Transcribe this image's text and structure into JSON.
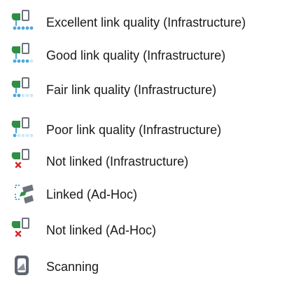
{
  "legend": {
    "items": [
      {
        "icon": "excellent-link-quality-infrastructure-icon",
        "label": "Excellent link quality (Infrastructure)"
      },
      {
        "icon": "good-link-quality-infrastructure-icon",
        "label": "Good link quality (Infrastructure)"
      },
      {
        "icon": "fair-link-quality-infrastructure-icon",
        "label": "Fair link quality (Infrastructure)"
      },
      {
        "icon": "poor-link-quality-infrastructure-icon",
        "label": "Poor link quality (Infrastructure)"
      },
      {
        "icon": "not-linked-infrastructure-icon",
        "label": "Not linked (Infrastructure)"
      },
      {
        "icon": "linked-ad-hoc-icon",
        "label": "Linked (Ad-Hoc)"
      },
      {
        "icon": "not-linked-ad-hoc-icon",
        "label": "Not linked (Ad-Hoc)"
      },
      {
        "icon": "scanning-icon",
        "label": "Scanning"
      }
    ]
  },
  "colors": {
    "text": "#1a1a1a",
    "device_green": "#2f8f45",
    "device_gray": "#6c737d",
    "signal_blue": "#4aa8e2",
    "signal_light_blue": "#cfe8f8",
    "error_red": "#d52a2a"
  }
}
